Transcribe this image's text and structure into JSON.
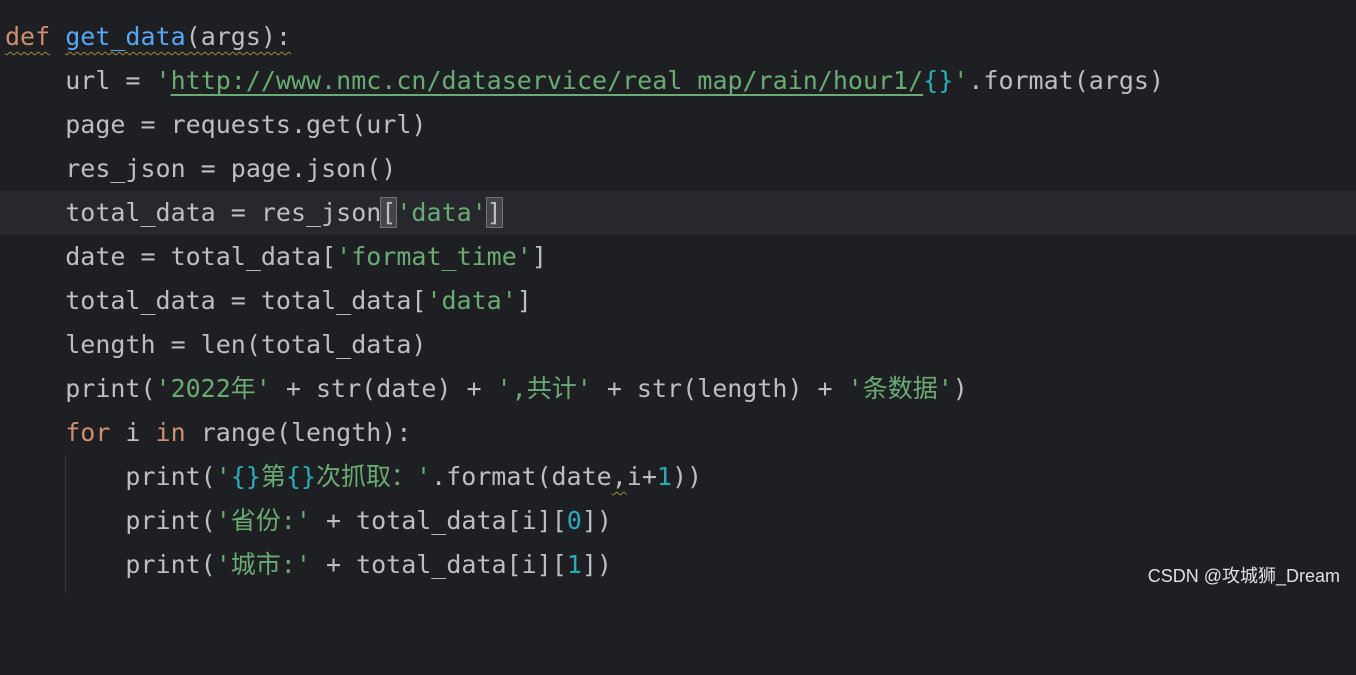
{
  "code": {
    "l1": {
      "kw_def": "def",
      "sp": " ",
      "fn_name": "get_data",
      "params": "(args):"
    },
    "l2": {
      "indent": "    ",
      "a": "url = ",
      "str_open": "'",
      "url": "http://www.nmc.cn/dataservice/real_map/rain/hour1/",
      "placeholder": "{}",
      "str_close": "'",
      "rest": ".format(args)"
    },
    "l3": {
      "indent": "    ",
      "text": "page = requests.get(url)"
    },
    "l4": {
      "indent": "    ",
      "text": "res_json = page.json()"
    },
    "l5": {
      "indent": "    ",
      "a": "total_data = res_json",
      "open_br": "[",
      "key": "'data'",
      "close_br": "]"
    },
    "l6": {
      "indent": "    ",
      "a": "date = total_data[",
      "key": "'format_time'",
      "b": "]"
    },
    "l7": {
      "indent": "    ",
      "a": "total_data = total_data[",
      "key": "'data'",
      "b": "]"
    },
    "l8": {
      "indent": "    ",
      "text": "length = len(total_data)"
    },
    "l9": {
      "indent": "    ",
      "a": "print(",
      "s1": "'2022年'",
      "b": " + str(date) + ",
      "s2": "',共计'",
      "c": " + str(length) + ",
      "s3": "'条数据'",
      "d": ")"
    },
    "l10": {
      "indent": "    ",
      "kw_for": "for",
      "a": " i ",
      "kw_in": "in",
      "b": " range(length):"
    },
    "l11": {
      "indent": "        ",
      "a": "print(",
      "q1": "'",
      "p1": "{}",
      "t1": "第",
      "p2": "{}",
      "t2": "次抓取：'",
      "b": ".format(date",
      "comma": ",",
      "c": "i+",
      "n": "1",
      "d": "))"
    },
    "l12": {
      "indent": "        ",
      "a": "print(",
      "s": "'省份:'",
      "b": " + total_data[i][",
      "n": "0",
      "c": "])"
    },
    "l13": {
      "indent": "        ",
      "a": "print(",
      "s": "'城市:'",
      "b": " + total_data[i][",
      "n": "1",
      "c": "])"
    }
  },
  "watermark": "CSDN @攻城狮_Dream",
  "colors": {
    "background": "#1e1f22",
    "keyword": "#cf8e6d",
    "function": "#56a8f5",
    "string": "#6aab73",
    "number": "#2aacb8",
    "text": "#bcbec4"
  }
}
